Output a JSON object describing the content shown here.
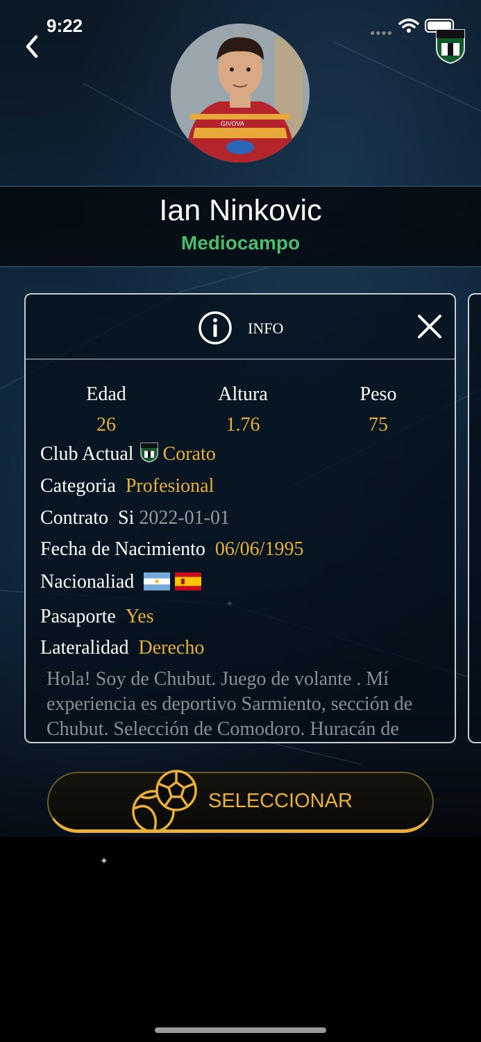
{
  "status_bar": {
    "time": "9:22"
  },
  "player": {
    "name": "Ian Ninkovic",
    "position": "Mediocampo",
    "jersey_text": "GIVOVA"
  },
  "card": {
    "title": "INFO",
    "stats": [
      {
        "label": "Edad",
        "value": "26"
      },
      {
        "label": "Altura",
        "value": "1.76"
      },
      {
        "label": "Peso",
        "value": "75"
      }
    ],
    "club": {
      "label": "Club Actual",
      "value": "Corato"
    },
    "category": {
      "label": "Categoria",
      "value": "Profesional"
    },
    "contract": {
      "label": "Contrato",
      "value": "Si",
      "date": "2022-01-01"
    },
    "birth": {
      "label": "Fecha de Nacimiento",
      "value": "06/06/1995"
    },
    "nationality": {
      "label": "Nacionaliad",
      "flags": [
        "argentina-flag",
        "spain-flag"
      ]
    },
    "passport": {
      "label": "Pasaporte",
      "value": "Yes"
    },
    "laterality": {
      "label": "Lateralidad",
      "value": "Derecho"
    },
    "bio": "Hola! Soy de Chubut. Juego de volante . Mí experiencia es deportivo Sarmiento, sección de Chubut. Selección de Comodoro. Huracán de"
  },
  "actions": {
    "select_label": "SELECCIONAR"
  },
  "colors": {
    "accent_gold": "#e9b03a",
    "position_green": "#4cbb6c",
    "card_border": "#c9ced3"
  },
  "icons": {
    "back": "chevron-left-icon",
    "info": "info-circle-icon",
    "close": "close-icon",
    "select": "globe-soccer-ball-icon"
  }
}
